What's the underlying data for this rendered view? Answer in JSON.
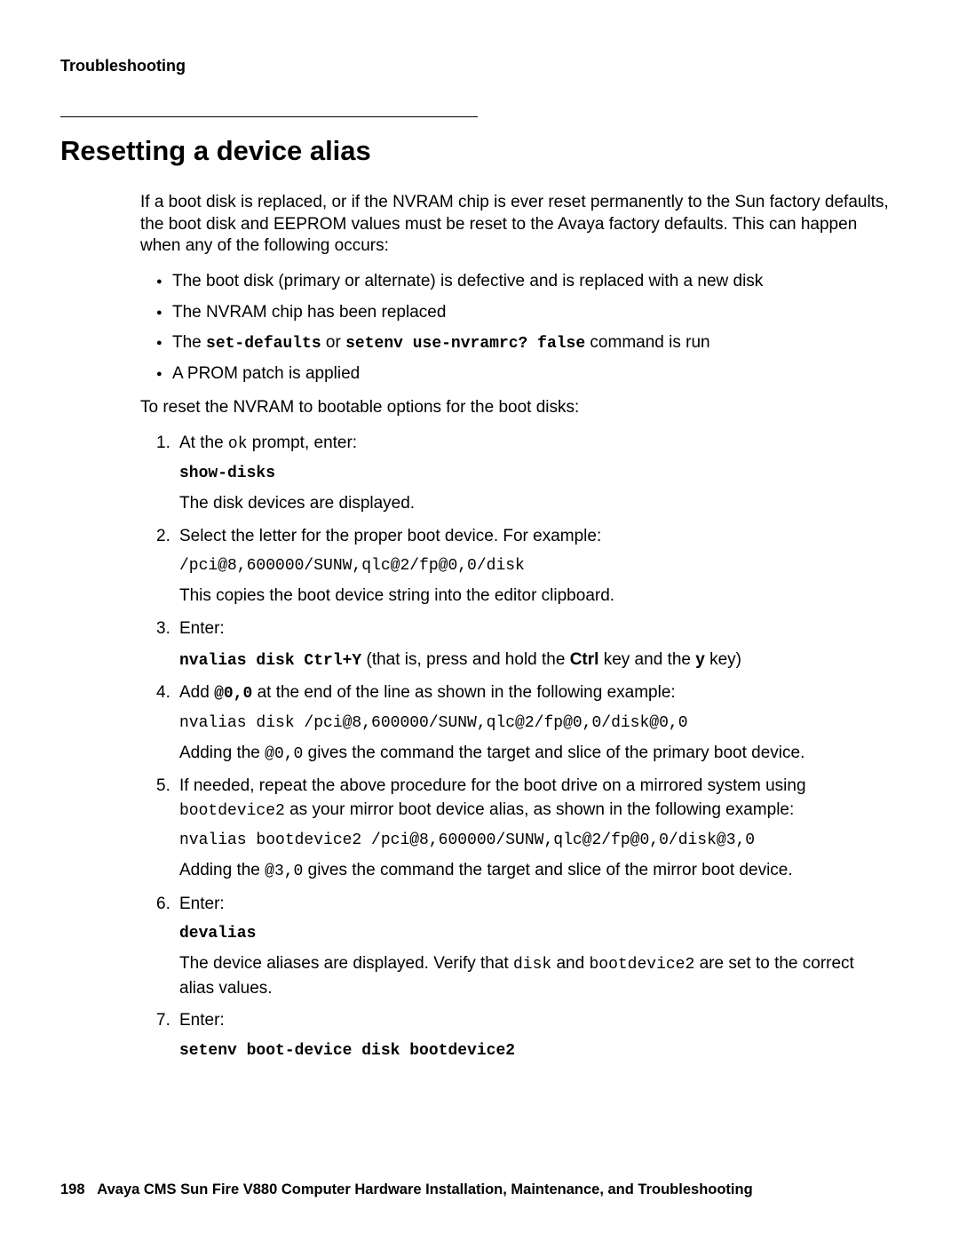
{
  "header": {
    "label": "Troubleshooting"
  },
  "heading": "Resetting a device alias",
  "intro": "If a boot disk is replaced, or if the NVRAM chip is ever reset permanently to the Sun factory defaults, the boot disk and EEPROM values must be reset to the Avaya factory defaults. This can happen when any of the following occurs:",
  "bullets": {
    "b1": "The boot disk (primary or alternate) is defective and is replaced with a new disk",
    "b2": "The NVRAM chip has been replaced",
    "b3_pre": "The ",
    "b3_cmd1": "set-defaults",
    "b3_or": " or ",
    "b3_cmd2": "setenv use-nvramrc? false",
    "b3_post": " command is run",
    "b4": "A PROM patch is applied"
  },
  "after_bullets": "To reset the NVRAM to bootable options for the boot disks:",
  "steps": {
    "s1": {
      "line_pre": "At the ",
      "ok": "ok",
      "line_post": " prompt, enter:",
      "cmd": "show-disks",
      "result": "The disk devices are displayed."
    },
    "s2": {
      "line": "Select the letter for the proper boot device. For example:",
      "path": "/pci@8,600000/SUNW,qlc@2/fp@0,0/disk",
      "result": "This copies the boot device string into the editor clipboard."
    },
    "s3": {
      "line": "Enter:",
      "cmd": "nvalias disk Ctrl+Y",
      "post1": " (that is, press and hold the ",
      "ctrl": "Ctrl",
      "post2": " key and the ",
      "ykey": "y",
      "post3": " key)"
    },
    "s4": {
      "pre": "Add ",
      "at": "@0,0",
      "post": " at the end of the line as shown in the following example:",
      "cmd": "nvalias disk /pci@8,600000/SUNW,qlc@2/fp@0,0/disk@0,0",
      "r_pre": "Adding the ",
      "r_at": "@0,0",
      "r_post": " gives the command the target and slice of the primary boot device."
    },
    "s5": {
      "line_pre": "If needed, repeat the above procedure for the boot drive on a mirrored system using ",
      "bd2": "bootdevice2",
      "line_post": " as your mirror boot device alias, as shown in the following example:",
      "cmd": "nvalias bootdevice2 /pci@8,600000/SUNW,qlc@2/fp@0,0/disk@3,0",
      "r_pre": "Adding the ",
      "r_at": "@3,0",
      "r_post": " gives the command the target and slice of the mirror boot device."
    },
    "s6": {
      "line": "Enter:",
      "cmd": "devalias",
      "r_pre": "The device aliases are displayed. Verify that ",
      "disk": "disk",
      "r_mid": " and ",
      "bd2": "bootdevice2",
      "r_post": " are set to the correct alias values."
    },
    "s7": {
      "line": "Enter:",
      "cmd": "setenv boot-device disk bootdevice2"
    }
  },
  "footer": {
    "page": "198",
    "title": "Avaya CMS Sun Fire V880 Computer Hardware Installation, Maintenance, and Troubleshooting"
  }
}
